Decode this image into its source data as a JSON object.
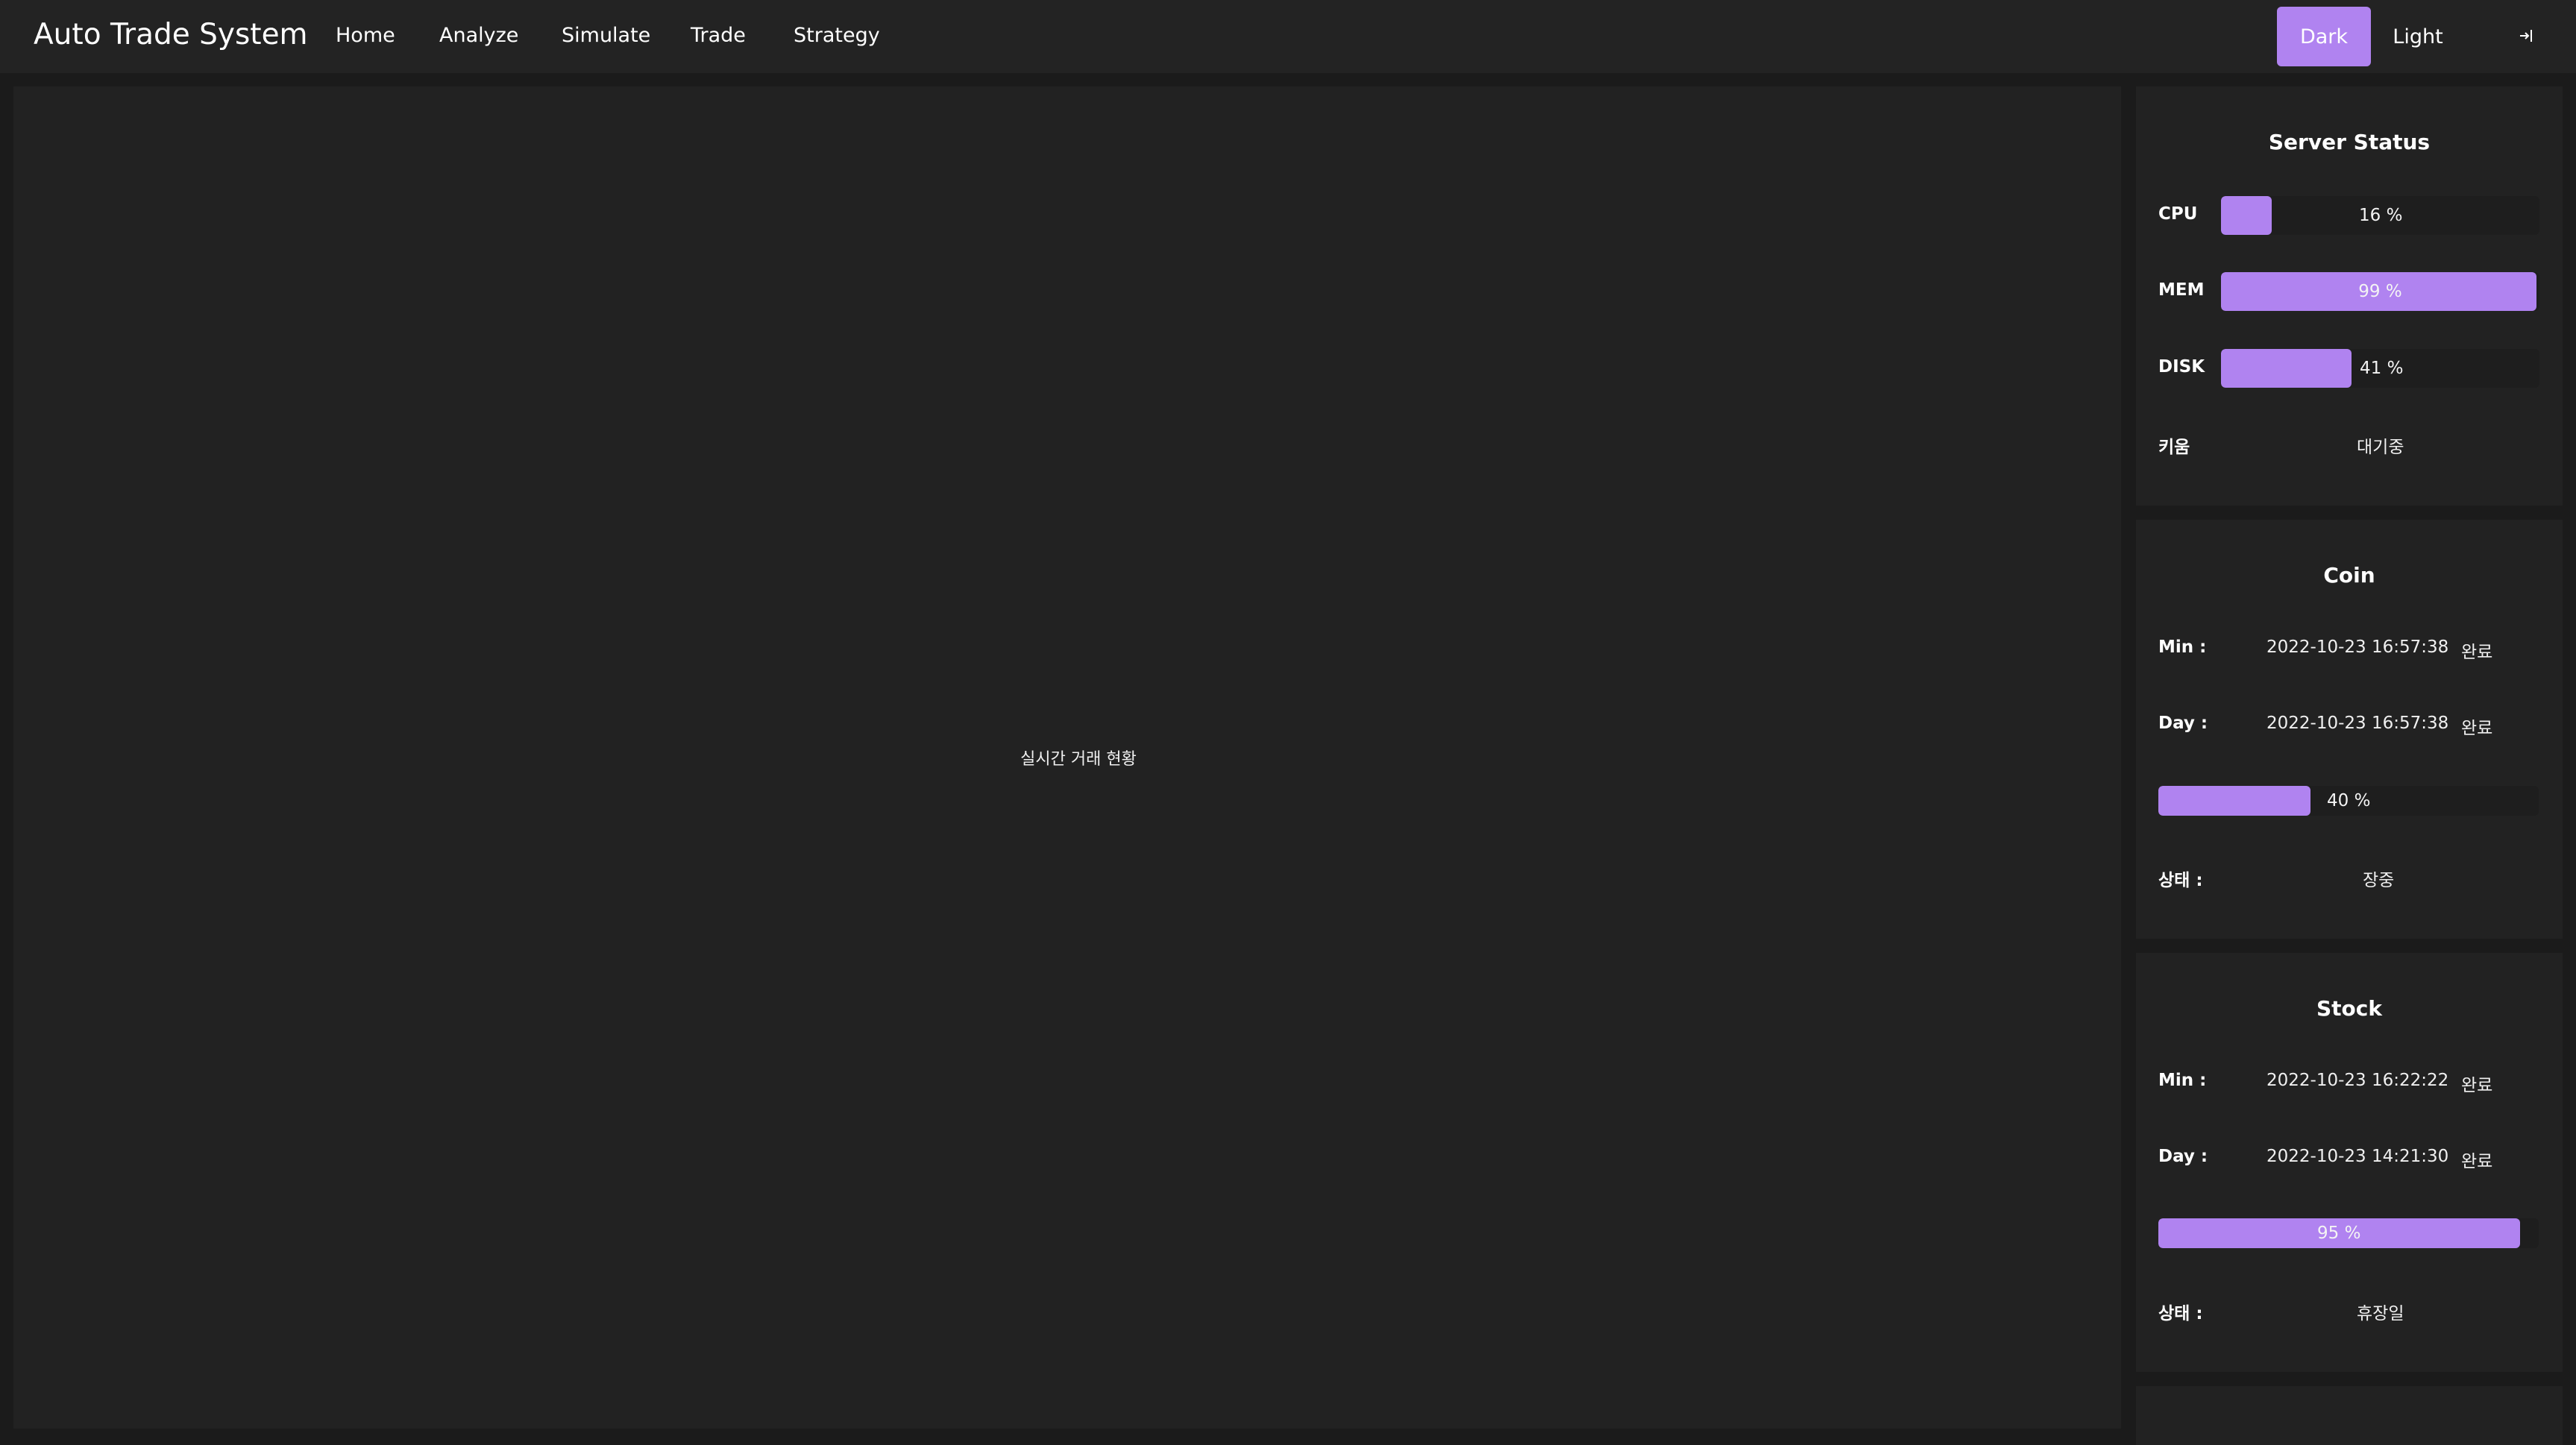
{
  "header": {
    "brand": "Auto Trade System",
    "nav": [
      "Home",
      "Analyze",
      "Simulate",
      "Trade",
      "Strategy"
    ],
    "theme_dark": "Dark",
    "theme_light": "Light",
    "logout_icon": "logout-icon",
    "accent_color": "#b083f0"
  },
  "main": {
    "placeholder": "실시간 거래 현황"
  },
  "server_status": {
    "title": "Server Status",
    "cpu_label": "CPU",
    "cpu_value": 16,
    "cpu_text": "16 %",
    "mem_label": "MEM",
    "mem_value": 99,
    "mem_text": "99 %",
    "disk_label": "DISK",
    "disk_value": 41,
    "disk_text": "41 %",
    "kiwoom_label": "키움",
    "kiwoom_status": "대기중"
  },
  "coin": {
    "title": "Coin",
    "min_label": "Min :",
    "min_time": "2022-10-23 16:57:38",
    "min_status": "완료",
    "day_label": "Day :",
    "day_time": "2022-10-23 16:57:38",
    "day_status": "완료",
    "progress_value": 40,
    "progress_text": "40 %",
    "state_label": "상태 :",
    "state_value": "장중"
  },
  "stock": {
    "title": "Stock",
    "min_label": "Min :",
    "min_time": "2022-10-23 16:22:22",
    "min_status": "완료",
    "day_label": "Day :",
    "day_time": "2022-10-23 14:21:30",
    "day_status": "완료",
    "progress_value": 95,
    "progress_text": "95 %",
    "state_label": "상태 :",
    "state_value": "휴장일"
  }
}
